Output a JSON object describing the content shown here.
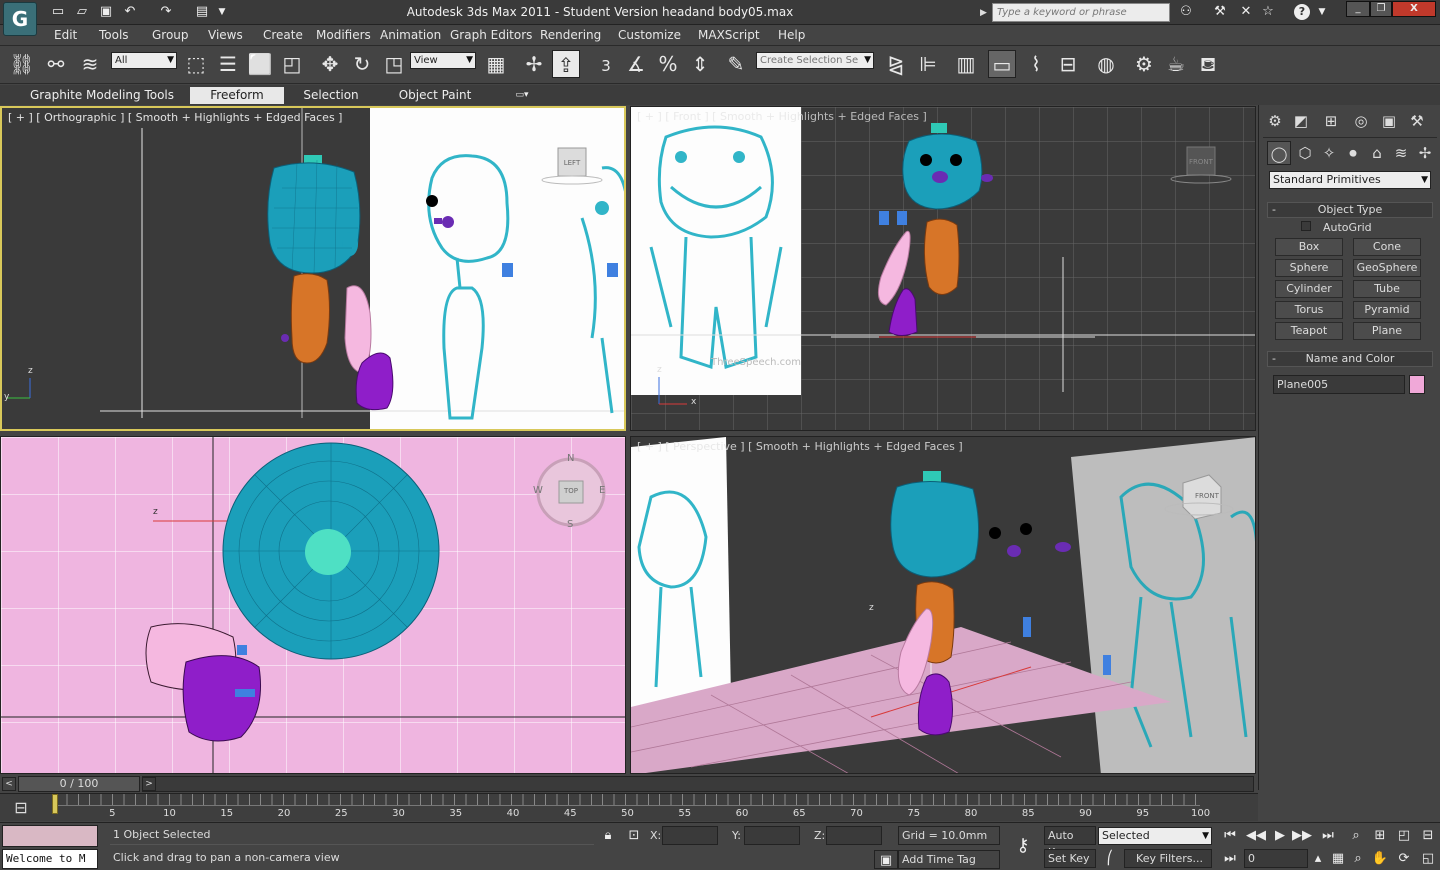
{
  "title": "Autodesk 3ds Max  2011  - Student Version    headand body05.max",
  "search": {
    "placeholder": "Type a keyword or phrase"
  },
  "menus": [
    "Edit",
    "Tools",
    "Group",
    "Views",
    "Create",
    "Modifiers",
    "Animation",
    "Graph Editors",
    "Rendering",
    "Customize",
    "MAXScript",
    "Help"
  ],
  "toolbar": {
    "selection_filter": "All",
    "ref_coord": "View",
    "named_selection": "Create Selection Se",
    "snap_label": "3"
  },
  "ribbon": {
    "tabs": [
      "Graphite Modeling Tools",
      "Freeform",
      "Selection",
      "Object Paint"
    ],
    "active": "Freeform"
  },
  "viewports": {
    "top_left": {
      "label": "[ + ] [ Orthographic ] [ Smooth + Highlights + Edged Faces ]",
      "cube": "LEFT",
      "axes": {
        "z": "z",
        "y": "y"
      }
    },
    "top_right": {
      "label": "[ + ] [ Front ] [ Smooth + Highlights + Edged Faces ]",
      "cube": "FRONT",
      "watermark": "ThreeSpeech.com",
      "axes": {
        "z": "z",
        "x": "x"
      }
    },
    "bottom_left": {
      "label": "",
      "compass": {
        "n": "N",
        "s": "S",
        "e": "E",
        "w": "W",
        "cube": "TOP"
      },
      "axes": {
        "z": "z"
      }
    },
    "bottom_right": {
      "label": "[ + ] [ Perspective ] [ Smooth + Highlights + Edged Faces ]",
      "cube": "FRONT",
      "axes": {
        "z": "z"
      }
    }
  },
  "command_panel": {
    "dropdown": "Standard Primitives",
    "object_type": {
      "title": "Object Type",
      "autogrid": "AutoGrid",
      "buttons": [
        "Box",
        "Cone",
        "Sphere",
        "GeoSphere",
        "Cylinder",
        "Tube",
        "Torus",
        "Pyramid",
        "Teapot",
        "Plane"
      ]
    },
    "name_color": {
      "title": "Name and Color",
      "name": "Plane005",
      "color": "#f0a8d8"
    }
  },
  "timeline": {
    "frame": "0 / 100",
    "ticks": [
      5,
      10,
      15,
      20,
      25,
      30,
      35,
      40,
      45,
      50,
      55,
      60,
      65,
      70,
      75,
      80,
      85,
      90,
      95,
      100
    ]
  },
  "status": {
    "selected": "1 Object Selected",
    "prompt": "Click and drag to pan a non-camera view",
    "welcome": "Welcome to M",
    "x_label": "X:",
    "y_label": "Y:",
    "z_label": "Z:",
    "grid": "Grid = 10.0mm",
    "add_time_tag": "Add Time Tag",
    "auto_key": "Auto Key",
    "set_key": "Set Key",
    "key_mode": "Selected",
    "key_filters": "Key Filters...",
    "frame_value": "0"
  }
}
